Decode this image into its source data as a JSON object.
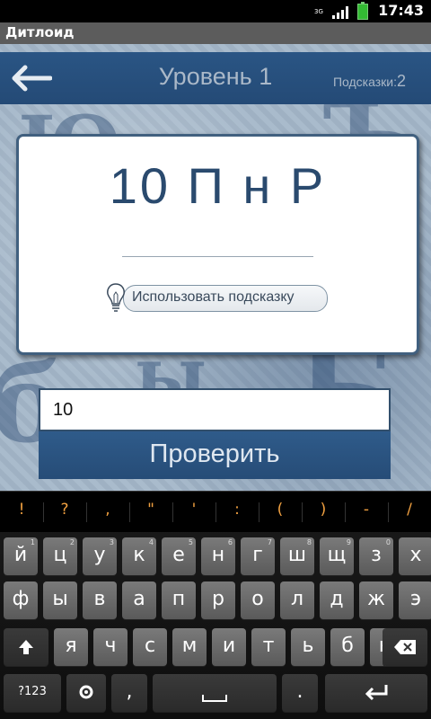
{
  "status_bar": {
    "network": "3G",
    "time": "17:43"
  },
  "app": {
    "title": "Дитлоид"
  },
  "header": {
    "level": "Уровень 1",
    "hints_label": "Подсказки:",
    "hints_count": "2"
  },
  "puzzle": {
    "text": "10 П н Р"
  },
  "hint_button": {
    "label": "Использовать подсказку"
  },
  "answer_input": {
    "value": "10"
  },
  "check_button": {
    "label": "Проверить"
  },
  "keyboard": {
    "suggestions": [
      "!",
      "?",
      ",",
      "\"",
      "'",
      ":",
      "(",
      ")",
      "-",
      "/"
    ],
    "row1": [
      "й",
      "ц",
      "у",
      "к",
      "е",
      "н",
      "г",
      "ш",
      "щ",
      "з",
      "х"
    ],
    "row1_digits": [
      "1",
      "2",
      "3",
      "4",
      "5",
      "6",
      "7",
      "8",
      "9",
      "0",
      ""
    ],
    "row2": [
      "ф",
      "ы",
      "в",
      "а",
      "п",
      "р",
      "о",
      "л",
      "д",
      "ж",
      "э"
    ],
    "row3": [
      "я",
      "ч",
      "с",
      "м",
      "и",
      "т",
      "ь",
      "б",
      "ю"
    ],
    "mode_key": "?123",
    "comma_key": ",",
    "period_key": "."
  },
  "colors": {
    "header": "#2a5584",
    "accent_text": "#f0a040",
    "card_text": "#2a4a6e"
  }
}
